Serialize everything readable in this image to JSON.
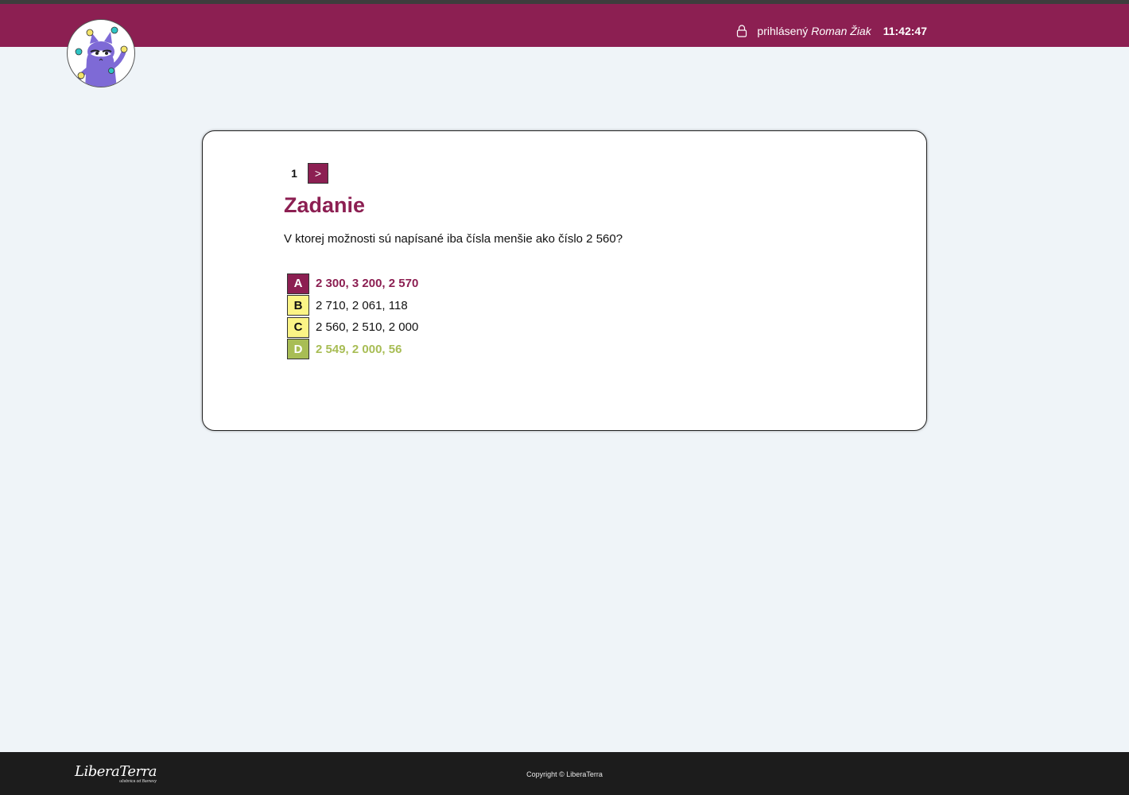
{
  "header": {
    "user_prefix": "prihlásený",
    "user_name": "Roman Žiak",
    "clock": "11:42:47",
    "lock_icon": "lock-icon",
    "background": "#8c1f52"
  },
  "logo": {
    "icon": "juggling-cat-logo"
  },
  "quiz": {
    "pager": {
      "current": "1",
      "next_label": ">"
    },
    "title": "Zadanie",
    "question": "V ktorej možnosti sú napísané iba čísla menšie ako číslo 2 560?",
    "options": [
      {
        "letter": "A",
        "text": "2 300, 3 200, 2 570",
        "state": "selected"
      },
      {
        "letter": "B",
        "text": "2 710, 2 061, 118",
        "state": "default"
      },
      {
        "letter": "C",
        "text": "2 560, 2 510, 2 000",
        "state": "default"
      },
      {
        "letter": "D",
        "text": "2 549, 2 000, 56",
        "state": "correct"
      }
    ],
    "colors": {
      "accent": "#8c1f52",
      "option_default": "#fbf486",
      "option_correct": "#a8bd55"
    }
  },
  "footer": {
    "brand": "LiberaTerra",
    "tagline": "učebnica od Barnevy",
    "copyright": "Copyright © LiberaTerra"
  }
}
